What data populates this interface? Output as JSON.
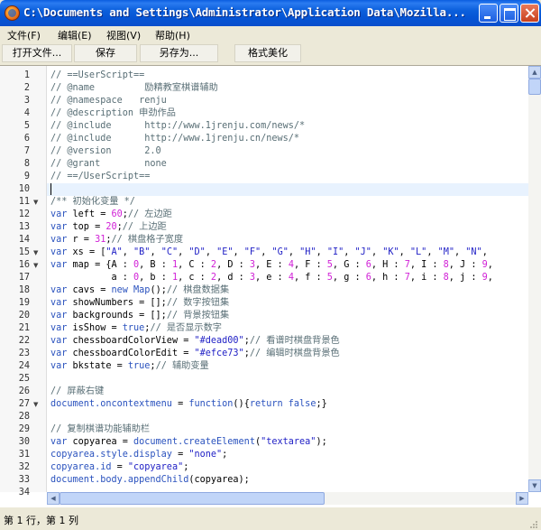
{
  "window": {
    "title": "C:\\Documents and Settings\\Administrator\\Application Data\\Mozilla...",
    "buttons": {
      "minimize": "minimize",
      "maximize": "maximize",
      "close": "close"
    }
  },
  "menu": [
    {
      "label": "文件(F)"
    },
    {
      "label": "编辑(E)"
    },
    {
      "label": "视图(V)"
    },
    {
      "label": "帮助(H)"
    }
  ],
  "toolbar": {
    "open_label": "打开文件...",
    "save_label": "保存",
    "save_as_label": "另存为...",
    "format_label": "格式美化"
  },
  "editor": {
    "current_line": 10,
    "fold_lines": [
      11,
      15,
      16,
      27
    ],
    "lines": [
      [
        [
          "c",
          "// ==UserScript=="
        ]
      ],
      [
        [
          "c",
          "// @name         励精教室棋谱辅助"
        ]
      ],
      [
        [
          "c",
          "// @namespace   renju"
        ]
      ],
      [
        [
          "c",
          "// @description 申劲作品"
        ]
      ],
      [
        [
          "c",
          "// @include      http://www.1jrenju.com/news/*"
        ]
      ],
      [
        [
          "c",
          "// @include      http://www.1jrenju.cn/news/*"
        ]
      ],
      [
        [
          "c",
          "// @version      2.0"
        ]
      ],
      [
        [
          "c",
          "// @grant        none"
        ]
      ],
      [
        [
          "c",
          "// ==/UserScript=="
        ]
      ],
      [
        [
          "t",
          ""
        ]
      ],
      [
        [
          "c",
          "/** 初始化变量 */"
        ]
      ],
      [
        [
          "k",
          "var"
        ],
        [
          "t",
          " left = "
        ],
        [
          "n",
          "60"
        ],
        [
          "t",
          ";"
        ],
        [
          "c",
          "// 左边距"
        ]
      ],
      [
        [
          "k",
          "var"
        ],
        [
          "t",
          " top = "
        ],
        [
          "n",
          "20"
        ],
        [
          "t",
          ";"
        ],
        [
          "c",
          "// 上边距"
        ]
      ],
      [
        [
          "k",
          "var"
        ],
        [
          "t",
          " r = "
        ],
        [
          "n",
          "31"
        ],
        [
          "t",
          ";"
        ],
        [
          "c",
          "// 棋盘格子宽度"
        ]
      ],
      [
        [
          "k",
          "var"
        ],
        [
          "t",
          " xs = ["
        ],
        [
          "s",
          "\"A\""
        ],
        [
          "t",
          ", "
        ],
        [
          "s",
          "\"B\""
        ],
        [
          "t",
          ", "
        ],
        [
          "s",
          "\"C\""
        ],
        [
          "t",
          ", "
        ],
        [
          "s",
          "\"D\""
        ],
        [
          "t",
          ", "
        ],
        [
          "s",
          "\"E\""
        ],
        [
          "t",
          ", "
        ],
        [
          "s",
          "\"F\""
        ],
        [
          "t",
          ", "
        ],
        [
          "s",
          "\"G\""
        ],
        [
          "t",
          ", "
        ],
        [
          "s",
          "\"H\""
        ],
        [
          "t",
          ", "
        ],
        [
          "s",
          "\"I\""
        ],
        [
          "t",
          ", "
        ],
        [
          "s",
          "\"J\""
        ],
        [
          "t",
          ", "
        ],
        [
          "s",
          "\"K\""
        ],
        [
          "t",
          ", "
        ],
        [
          "s",
          "\"L\""
        ],
        [
          "t",
          ", "
        ],
        [
          "s",
          "\"M\""
        ],
        [
          "t",
          ", "
        ],
        [
          "s",
          "\"N\""
        ],
        [
          "t",
          ","
        ]
      ],
      [
        [
          "k",
          "var"
        ],
        [
          "t",
          " map = {A : "
        ],
        [
          "n",
          "0"
        ],
        [
          "t",
          ", B : "
        ],
        [
          "n",
          "1"
        ],
        [
          "t",
          ", C : "
        ],
        [
          "n",
          "2"
        ],
        [
          "t",
          ", D : "
        ],
        [
          "n",
          "3"
        ],
        [
          "t",
          ", E : "
        ],
        [
          "n",
          "4"
        ],
        [
          "t",
          ", F : "
        ],
        [
          "n",
          "5"
        ],
        [
          "t",
          ", G : "
        ],
        [
          "n",
          "6"
        ],
        [
          "t",
          ", H : "
        ],
        [
          "n",
          "7"
        ],
        [
          "t",
          ", I : "
        ],
        [
          "n",
          "8"
        ],
        [
          "t",
          ", J : "
        ],
        [
          "n",
          "9"
        ],
        [
          "t",
          ","
        ]
      ],
      [
        [
          "t",
          "           a : "
        ],
        [
          "n",
          "0"
        ],
        [
          "t",
          ", b : "
        ],
        [
          "n",
          "1"
        ],
        [
          "t",
          ", c : "
        ],
        [
          "n",
          "2"
        ],
        [
          "t",
          ", d : "
        ],
        [
          "n",
          "3"
        ],
        [
          "t",
          ", e : "
        ],
        [
          "n",
          "4"
        ],
        [
          "t",
          ", f : "
        ],
        [
          "n",
          "5"
        ],
        [
          "t",
          ", g : "
        ],
        [
          "n",
          "6"
        ],
        [
          "t",
          ", h : "
        ],
        [
          "n",
          "7"
        ],
        [
          "t",
          ", i : "
        ],
        [
          "n",
          "8"
        ],
        [
          "t",
          ", j : "
        ],
        [
          "n",
          "9"
        ],
        [
          "t",
          ","
        ]
      ],
      [
        [
          "k",
          "var"
        ],
        [
          "t",
          " cavs = "
        ],
        [
          "k",
          "new"
        ],
        [
          "t",
          " "
        ],
        [
          "k",
          "Map"
        ],
        [
          "t",
          "();"
        ],
        [
          "c",
          "// 棋盘数据集"
        ]
      ],
      [
        [
          "k",
          "var"
        ],
        [
          "t",
          " showNumbers = [];"
        ],
        [
          "c",
          "// 数字按钮集"
        ]
      ],
      [
        [
          "k",
          "var"
        ],
        [
          "t",
          " backgrounds = [];"
        ],
        [
          "c",
          "// 背景按钮集"
        ]
      ],
      [
        [
          "k",
          "var"
        ],
        [
          "t",
          " isShow = "
        ],
        [
          "k",
          "true"
        ],
        [
          "t",
          ";"
        ],
        [
          "c",
          "// 是否显示数字"
        ]
      ],
      [
        [
          "k",
          "var"
        ],
        [
          "t",
          " chessboardColorView = "
        ],
        [
          "s",
          "\"#dead00\""
        ],
        [
          "t",
          ";"
        ],
        [
          "c",
          "// 看谱时棋盘背景色"
        ]
      ],
      [
        [
          "k",
          "var"
        ],
        [
          "t",
          " chessboardColorEdit = "
        ],
        [
          "s",
          "\"#efce73\""
        ],
        [
          "t",
          ";"
        ],
        [
          "c",
          "// 编辑时棋盘背景色"
        ]
      ],
      [
        [
          "k",
          "var"
        ],
        [
          "t",
          " bkstate = "
        ],
        [
          "k",
          "true"
        ],
        [
          "t",
          ";"
        ],
        [
          "c",
          "// 辅助变量"
        ]
      ],
      [
        [
          "t",
          ""
        ]
      ],
      [
        [
          "c",
          "// 屏蔽右键"
        ]
      ],
      [
        [
          "p",
          "document.oncontextmenu"
        ],
        [
          "t",
          " = "
        ],
        [
          "k",
          "function"
        ],
        [
          "t",
          "(){"
        ],
        [
          "k",
          "return"
        ],
        [
          "t",
          " "
        ],
        [
          "k",
          "false"
        ],
        [
          "t",
          ";}"
        ]
      ],
      [
        [
          "t",
          ""
        ]
      ],
      [
        [
          "c",
          "// 复制棋谱功能辅助栏"
        ]
      ],
      [
        [
          "k",
          "var"
        ],
        [
          "t",
          " copyarea = "
        ],
        [
          "p",
          "document.createElement"
        ],
        [
          "t",
          "("
        ],
        [
          "s",
          "\"textarea\""
        ],
        [
          "t",
          ");"
        ]
      ],
      [
        [
          "p",
          "copyarea.style.display"
        ],
        [
          "t",
          " = "
        ],
        [
          "s",
          "\"none\""
        ],
        [
          "t",
          ";"
        ]
      ],
      [
        [
          "p",
          "copyarea.id"
        ],
        [
          "t",
          " = "
        ],
        [
          "s",
          "\"copyarea\""
        ],
        [
          "t",
          ";"
        ]
      ],
      [
        [
          "p",
          "document.body.appendChild"
        ],
        [
          "t",
          "(copyarea);"
        ]
      ],
      [
        [
          "t",
          ""
        ]
      ]
    ]
  },
  "status": {
    "text": "第 1 行，第 1 列"
  },
  "icons": {
    "app": "firefox-icon",
    "scroll_up": "▲",
    "scroll_down": "▼",
    "scroll_left": "◀",
    "scroll_right": "▶",
    "fold": "▼"
  }
}
